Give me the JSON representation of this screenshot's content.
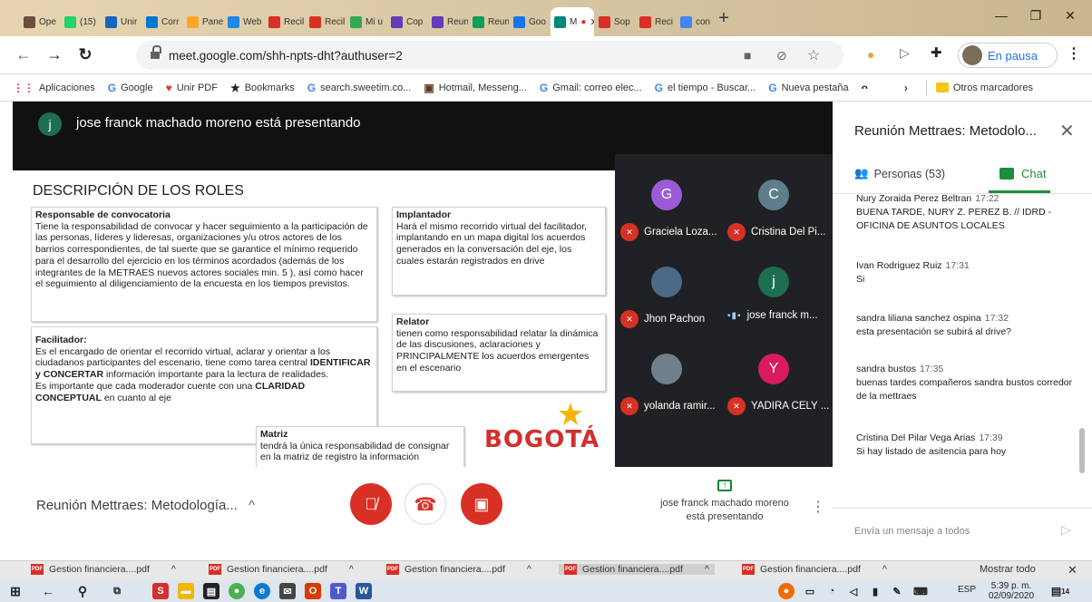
{
  "browser": {
    "tabs": [
      {
        "label": "Ope",
        "color": "#6d4c41"
      },
      {
        "label": "(15)",
        "color": "#25d366"
      },
      {
        "label": "Unir",
        "color": "#1565c0"
      },
      {
        "label": "Corr",
        "color": "#0078d4"
      },
      {
        "label": "Pane",
        "color": "#f9a825"
      },
      {
        "label": "Web",
        "color": "#1e88e5"
      },
      {
        "label": "Recil",
        "color": "#d93025"
      },
      {
        "label": "Recil",
        "color": "#d93025"
      },
      {
        "label": "Mi u",
        "color": "#34a853"
      },
      {
        "label": "Cop",
        "color": "#673ab7"
      },
      {
        "label": "Reun",
        "color": "#673ab7"
      },
      {
        "label": "Reun",
        "color": "#0f9d58"
      },
      {
        "label": "Goo",
        "color": "#1a73e8"
      },
      {
        "label": "M",
        "color": "#00897b"
      },
      {
        "label": "Sop",
        "color": "#d93025"
      },
      {
        "label": "Reci",
        "color": "#d93025"
      },
      {
        "label": "con",
        "color": "#4285f4"
      }
    ],
    "new_tab": "+",
    "url": "meet.google.com/shh-npts-dht?authuser=2",
    "profile_label": "En pausa",
    "bookmarks": [
      {
        "label": "Aplicaciones",
        "icon": "apps-icon",
        "color": "#ea4335"
      },
      {
        "label": "Google",
        "icon": "google-icon",
        "color": "#4285f4"
      },
      {
        "label": "Unir PDF",
        "icon": "heart-icon",
        "color": "#e53935"
      },
      {
        "label": "Bookmarks",
        "icon": "star-icon",
        "color": "#202124"
      },
      {
        "label": "search.sweetim.co...",
        "icon": "google-icon",
        "color": "#4285f4"
      },
      {
        "label": "Hotmail, Messeng...",
        "icon": "msn-icon",
        "color": "#5c3a21"
      },
      {
        "label": "Gmail: correo elec...",
        "icon": "google-icon",
        "color": "#4285f4"
      },
      {
        "label": "el tiempo - Buscar...",
        "icon": "google-icon",
        "color": "#4285f4"
      },
      {
        "label": "Nueva pestaña",
        "icon": "google-icon",
        "color": "#4285f4"
      }
    ],
    "other_bookmarks": "Otros marcadores"
  },
  "meet": {
    "presenter_initial": "j",
    "presenting_text": "jose franck machado moreno está presentando",
    "slide": {
      "title": "DESCRIPCIÓN DE LOS ROLES",
      "box1_head": "Responsable de convocatoria",
      "box1_body": "Tiene la responsabilidad de convocar y hacer seguimiento a la participación de las personas, líderes y lideresas, organizaciones y/u otros actores de los barrios correspondientes, de tal suerte que se garantice el mínimo requerido para el desarrollo del ejercicio en los términos acordados (además de los integrantes de la METRAES nuevos actores sociales min. 5 ),  así como hacer el seguimiento al diligenciamiento de la encuesta en los tiempos previstos.",
      "box2_head": "Facilitador:",
      "box2_p1": "Es el encargado de orientar el recorrido virtual, aclarar y orientar a los ciudadanos participantes del escenario, tiene como tarea central ",
      "box2_b1": "IDENTIFICAR y CONCERTAR",
      "box2_p2": " información importante para la lectura de realidades.",
      "box2_p3": "Es importante que cada moderador cuente con una ",
      "box2_b2": "CLARIDAD CONCEPTUAL",
      "box2_p4": " en cuanto al eje",
      "box3_head": "Implantador",
      "box3_body": "Hará el mismo recorrido virtual del facilitador, implantando en un mapa digital los acuerdos generados en la conversación del eje, los cuales estarán registrados en drive",
      "box4_head": "Relator",
      "box4_body": "tienen como responsabilidad relatar  la dinámica de las discusiones, aclaraciones y PRINCIPALMENTE los acuerdos emergentes en el escenario",
      "box5_head": "Matriz",
      "box5_body": "tendrá la única responsabilidad de consignar en la matriz de registro la información",
      "logo": "BOGOTÁ"
    },
    "participants": [
      {
        "name": "Graciela Loza...",
        "initial": "G",
        "color": "#9c5bd6",
        "muted": true
      },
      {
        "name": "Cristina Del Pi...",
        "initial": "C",
        "color": "#607d8b",
        "muted": true
      },
      {
        "name": "Jhon Pachon",
        "initial": "",
        "color": "#4a6b88",
        "muted": true
      },
      {
        "name": "jose franck m...",
        "initial": "j",
        "color": "#1e6e50",
        "muted": false
      },
      {
        "name": "yolanda ramir...",
        "initial": "",
        "color": "#6f7f8c",
        "muted": true
      },
      {
        "name": "YADIRA CELY ...",
        "initial": "Y",
        "color": "#d81b60",
        "muted": true
      }
    ],
    "panel": {
      "title": "Reunión Mettraes: Metodolo...",
      "people_tab": "Personas (53)",
      "chat_tab": "Chat",
      "messages": [
        {
          "sender": "Nury Zoraida Perez Beltran",
          "time": "17:22",
          "text": "BUENA TARDE, NURY Z. PEREZ B.  // IDRD - OFICINA DE ASUNTOS LOCALES"
        },
        {
          "sender": "Ivan Rodriguez Ruiz",
          "time": "17:31",
          "text": "Si"
        },
        {
          "sender": "sandra liliana sanchez ospina",
          "time": "17:32",
          "text": "esta presentación se subirá al drive?"
        },
        {
          "sender": "sandra bustos",
          "time": "17:35",
          "text": "buenas tardes compañeros sandra bustos corredor de la mettraes"
        },
        {
          "sender": "Cristina Del Pilar Vega Arias",
          "time": "17:39",
          "text": "Si hay listado de asitencia para hoy"
        }
      ],
      "input_placeholder": "Envía un mensaje a todos"
    },
    "meeting_title": "Reunión Mettraes: Metodología...",
    "presenting_line1": "jose franck machado moreno",
    "presenting_line2": "está presentando"
  },
  "downloads": {
    "items": [
      "Gestion financiera....pdf",
      "Gestion financiera....pdf",
      "Gestion financiera....pdf",
      "Gestion financiera....pdf",
      "Gestion financiera....pdf"
    ],
    "show_all": "Mostrar todo"
  },
  "taskbar": {
    "lang": "ESP",
    "time": "5:39 p. m.",
    "date": "02/09/2020",
    "notification_count": "14"
  }
}
